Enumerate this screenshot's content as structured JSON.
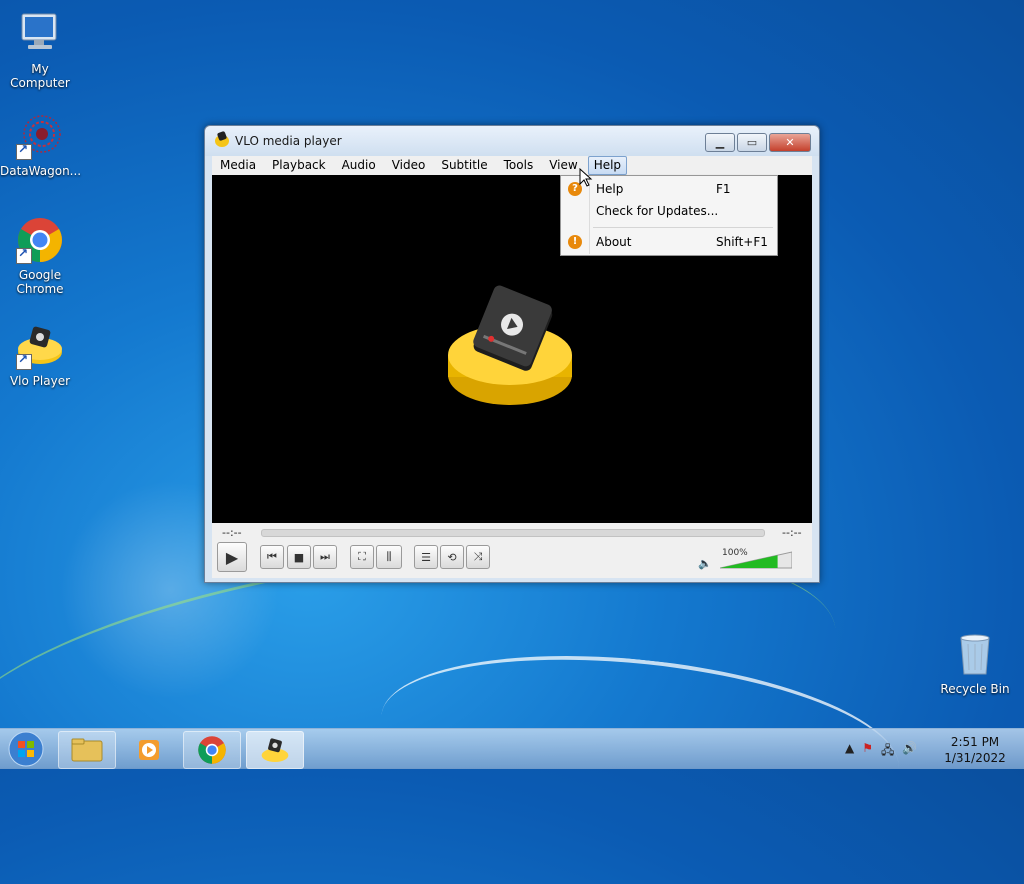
{
  "desktop": {
    "icons": [
      {
        "label": "My Computer"
      },
      {
        "label": "DataWagon..."
      },
      {
        "label": "Google Chrome"
      },
      {
        "label": "Vlo Player"
      },
      {
        "label": "Recycle Bin"
      }
    ]
  },
  "window": {
    "title": "VLO media player",
    "menu": [
      "Media",
      "Playback",
      "Audio",
      "Video",
      "Subtitle",
      "Tools",
      "View",
      "Help"
    ],
    "active_menu": "Help",
    "help_menu": [
      {
        "label": "Help",
        "shortcut": "F1",
        "icon": "help-icon"
      },
      {
        "label": "Check for Updates...",
        "shortcut": ""
      },
      {
        "label": "About",
        "shortcut": "Shift+F1",
        "icon": "info-icon"
      }
    ],
    "controls": {
      "elapsed": "--:--",
      "remaining": "--:--",
      "volume_label": "100%",
      "volume_level": 1.0
    }
  },
  "taskbar": {
    "time": "2:51 PM",
    "date": "1/31/2022"
  },
  "colors": {
    "menu_accent": "#e8890c",
    "volume_green": "#22bb22",
    "logo_yellow": "#f5c518"
  }
}
